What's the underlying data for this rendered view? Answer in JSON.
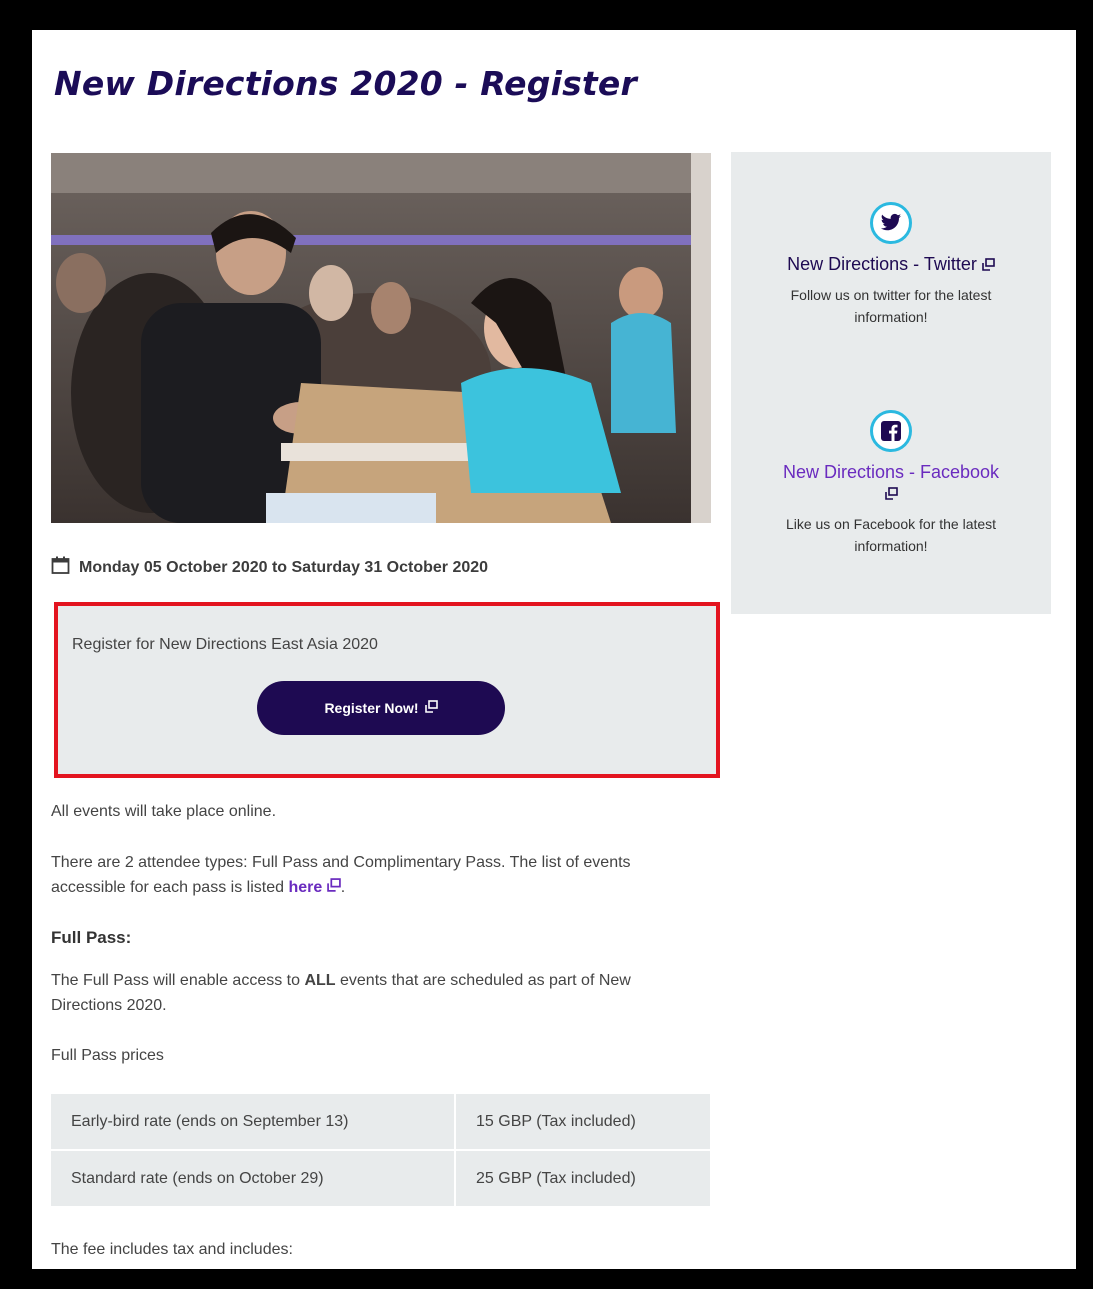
{
  "page": {
    "title": "New Directions 2020 - Register"
  },
  "event": {
    "date_range": "Monday 05 October 2020 to Saturday 31 October 2020",
    "calendar_icon": "calendar-icon"
  },
  "register_box": {
    "text": "Register for New Directions East Asia 2020",
    "button_label": "Register Now!",
    "button_color": "#1e0a52",
    "highlight_color": "#e3141f"
  },
  "sidebar": {
    "twitter": {
      "icon": "twitter-icon",
      "link_label": "New Directions - Twitter",
      "description": "Follow us on twitter for the latest information!"
    },
    "facebook": {
      "icon": "facebook-icon",
      "link_label": "New Directions - Facebook",
      "description": "Like us on Facebook for the latest information!"
    },
    "accent_color": "#2bb9e0"
  },
  "content": {
    "online_note": "All events will take place online.",
    "attendee_types_text": "There are 2 attendee types: Full Pass and Complimentary Pass. The list of events accessible for each pass is listed ",
    "attendee_link": "here",
    "attendee_suffix": ".",
    "full_pass_heading": "Full Pass:",
    "full_pass_text_before": "The Full Pass will enable access to ",
    "full_pass_text_bold": "ALL",
    "full_pass_text_after": " events that are scheduled as part of New Directions 2020.",
    "prices_label": "Full Pass prices",
    "prices": [
      {
        "rate": "Early-bird rate (ends on September 13)",
        "price": "15 GBP (Tax included)"
      },
      {
        "rate": "Standard rate (ends on October 29)",
        "price": "25 GBP (Tax included)"
      }
    ],
    "fee_note": "The fee includes tax and includes:"
  }
}
